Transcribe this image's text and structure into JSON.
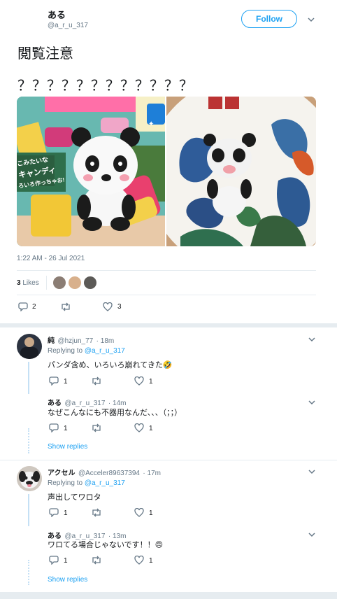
{
  "tweet": {
    "display_name": "ある",
    "handle": "@a_r_u_317",
    "follow_label": "Follow",
    "text_line1": "閲覧注意",
    "text_line2": "？？？？？？？？？？？？",
    "timestamp": "1:22 AM - 26 Jul 2021",
    "likes_count": "3",
    "likes_label": "Likes",
    "reply_count": "2",
    "like_count": "3",
    "image_left_text": {
      "jp1": "こみたいな",
      "jp2": "キャンディ",
      "jp3": "ろいろ作っちゃお!"
    }
  },
  "replies": [
    {
      "name": "純",
      "handle": "@hzjun_77",
      "time": "· 18m",
      "replying_prefix": "Replying to",
      "replying_to": "@a_r_u_317",
      "text": "パンダ含め、いろいろ崩れてきた🤣",
      "reply_count": "1",
      "like_count": "1"
    },
    {
      "name": "ある",
      "handle": "@a_r_u_317",
      "time": "· 14m",
      "text": "なぜこんなにも不器用なんだ、、、（；；）",
      "reply_count": "1",
      "like_count": "1",
      "show_replies": "Show replies"
    },
    {
      "name": "アクセル",
      "handle": "@Acceler89637394",
      "time": "· 17m",
      "replying_prefix": "Replying to",
      "replying_to": "@a_r_u_317",
      "text": "声出してワロタ",
      "reply_count": "1",
      "like_count": "1"
    },
    {
      "name": "ある",
      "handle": "@a_r_u_317",
      "time": "· 13m",
      "text": "ワロてる場合じゃないです！！😠",
      "reply_count": "1",
      "like_count": "1",
      "show_replies": "Show replies"
    }
  ],
  "colors": {
    "accent": "#1da1f2",
    "muted": "#657786",
    "separator": "#e6ecf0",
    "thread_line": "#c4e0f5"
  }
}
